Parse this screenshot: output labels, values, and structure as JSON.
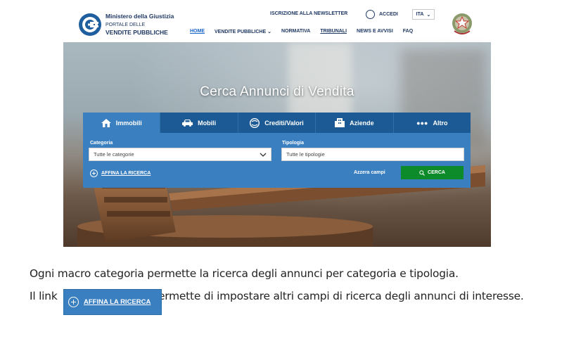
{
  "portal": {
    "logo": {
      "line1": "Ministero della Giustizia",
      "line2": "PORTALE DELLE",
      "line3": "VENDITE PUBBLICHE"
    },
    "newsletter_label": "ISCRIZIONE ALLA NEWSLETTER",
    "accedi_label": "ACCEDI",
    "language": "ITA",
    "nav": [
      {
        "label": "HOME"
      },
      {
        "label": "VENDITE PUBBLICHE"
      },
      {
        "label": "NORMATIVA"
      },
      {
        "label": "TRIBUNALI"
      },
      {
        "label": "NEWS E AVVISI"
      },
      {
        "label": "FAQ"
      }
    ],
    "hero_title": "Cerca Annunci di Vendita",
    "tabs": [
      {
        "label": "Immobili",
        "icon": "house-icon"
      },
      {
        "label": "Mobili",
        "icon": "car-icon"
      },
      {
        "label": "Crediti/Valori",
        "icon": "coins-icon"
      },
      {
        "label": "Aziende",
        "icon": "building-icon"
      },
      {
        "label": "Altro",
        "icon": "dots-icon"
      }
    ],
    "categoria": {
      "label": "Categoria",
      "value": "Tutte le categorie"
    },
    "tipologia": {
      "label": "Tipologia",
      "value": "Tutte le tipologie"
    },
    "affina_label": "AFFINA LA RICERCA",
    "azzera_label": "Azzera campi",
    "cerca_label": "CERCA"
  },
  "description": {
    "line1": "Ogni macro categoria permette la ricerca degli annunci per categoria e tipologia.",
    "line2_start": "Il link",
    "line2_end": "ermette di impostare altri campi di ricerca degli annunci di interesse.",
    "inline_button_label": "AFFINA LA RICERCA"
  },
  "colors": {
    "tab_bar": "#1b5a95",
    "panel": "#3a7fc0",
    "cerca_button": "#0d8a2a",
    "brand_text": "#1f3864"
  }
}
